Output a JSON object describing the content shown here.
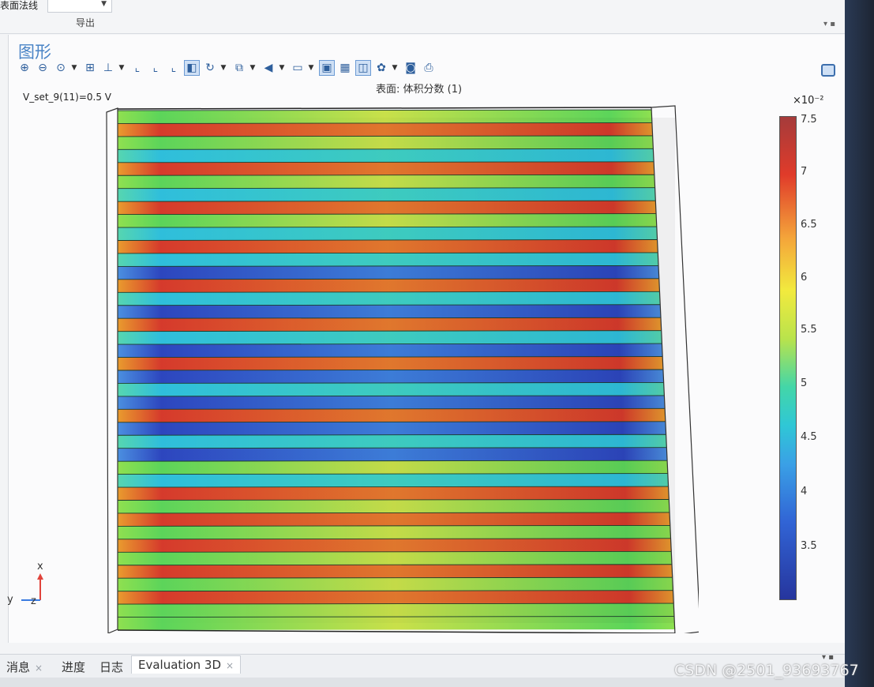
{
  "ribbon": {
    "field_label": "表面法线",
    "export_label": "导出",
    "pin_glyph": "▾ ▪"
  },
  "panel": {
    "title": "图形",
    "toolbar_icons": [
      "zoom-in-icon",
      "zoom-out-icon",
      "zoom-box-icon",
      "zoom-extents-icon",
      "axis-orientation-icon",
      "xy-view-icon",
      "yz-view-icon",
      "xz-view-icon",
      "view-default-icon",
      "rotate-icon",
      "selection-mode-icon",
      "light-icon",
      "transparency-icon",
      "wireframe-icon",
      "grid-icon",
      "scene-light-icon",
      "render-icon",
      "camera-icon",
      "print-icon"
    ]
  },
  "plot": {
    "expression": "V_set_9(11)=0.5 V",
    "title": "表面: 体积分数 (1)"
  },
  "colorbar": {
    "exponent": "×10⁻²",
    "ticks": [
      "7.5",
      "7",
      "6.5",
      "6",
      "5.5",
      "5",
      "4.5",
      "4",
      "3.5"
    ]
  },
  "axes": {
    "x": "x",
    "y": "y",
    "z": "z"
  },
  "tabs": [
    {
      "label": "消息",
      "close": "×"
    },
    {
      "label": "进度",
      "close": ""
    },
    {
      "label": "日志",
      "close": ""
    },
    {
      "label": "Evaluation 3D",
      "close": "×"
    }
  ],
  "watermark": "CSDN @2501_93693767",
  "colors": {
    "accent": "#4a84c6",
    "red": "#d43a2e",
    "green": "#5fd35a",
    "cyan": "#2fc7d6",
    "blue": "#2f50c8"
  }
}
